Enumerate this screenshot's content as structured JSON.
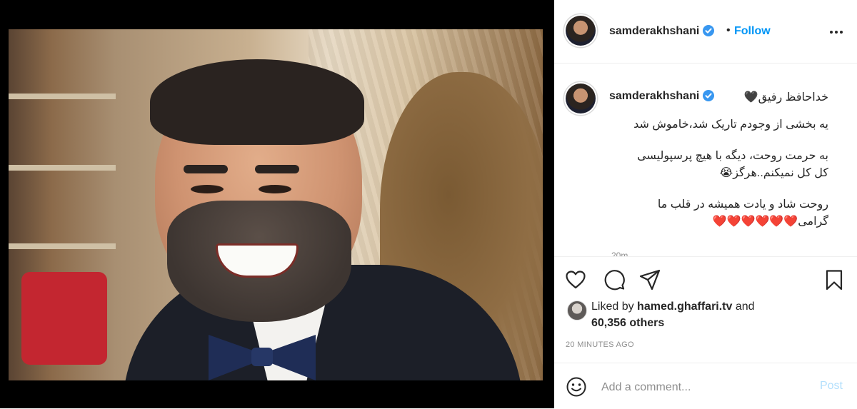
{
  "post": {
    "username": "samderakhshani",
    "follow_label": "Follow",
    "header_separator": "•"
  },
  "caption": {
    "username": "samderakhshani",
    "lines": [
      "خداحافظ رفیق🖤",
      "یه بخشی از وجودم تاریک شد،خاموش شد",
      "",
      "به حرمت روحت، دیگه با هیچ پرسپولیسی",
      "کل کل نمیکنم..هرگز😭",
      "",
      "روحت شاد و یادت همیشه در قلب ما",
      "گرامی❤️❤️❤️❤️❤️❤️"
    ],
    "time_peek": "20m"
  },
  "actions": {
    "icons": [
      "heart-icon",
      "comment-icon",
      "share-icon",
      "bookmark-icon"
    ]
  },
  "likes": {
    "prefix": "Liked by",
    "liker": "hamed.ghaffari.tv",
    "conjunction": "and",
    "others": "60,356 others"
  },
  "posted_time": "20 MINUTES AGO",
  "comment": {
    "placeholder": "Add a comment...",
    "post_label": "Post"
  },
  "colors": {
    "accent": "#0095f6",
    "post_disabled": "#b2dffc",
    "text": "#262626",
    "muted": "#8e8e8e",
    "verified": "#3897f0"
  }
}
